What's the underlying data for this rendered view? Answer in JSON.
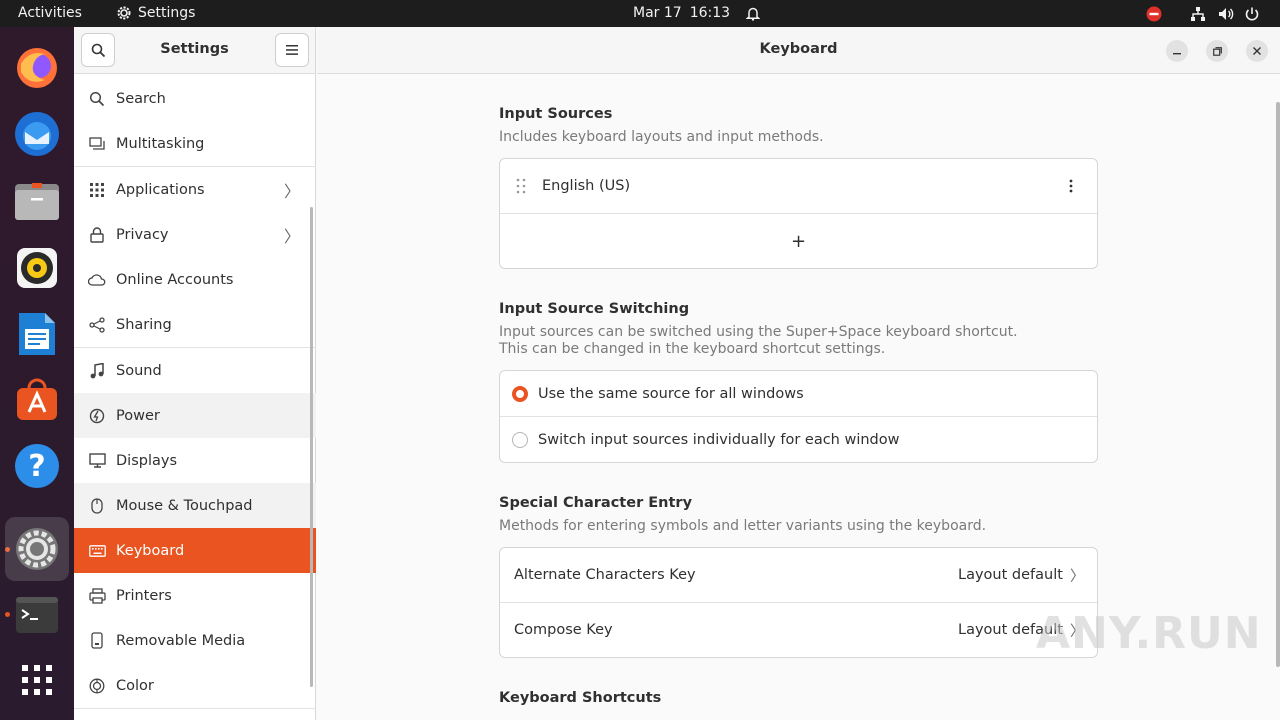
{
  "topbar": {
    "activities": "Activities",
    "app_name": "Settings",
    "date": "Mar 17",
    "time": "16:13"
  },
  "sidebar": {
    "title": "Settings",
    "items": [
      {
        "label": "Search",
        "icon": "search-icon"
      },
      {
        "label": "Multitasking",
        "icon": "multitasking-icon"
      },
      {
        "label": "Applications",
        "icon": "applications-grid-icon"
      },
      {
        "label": "Privacy",
        "icon": "lock-icon"
      },
      {
        "label": "Online Accounts",
        "icon": "cloud-icon"
      },
      {
        "label": "Sharing",
        "icon": "share-icon"
      },
      {
        "label": "Sound",
        "icon": "music-note-icon"
      },
      {
        "label": "Power",
        "icon": "power-icon"
      },
      {
        "label": "Displays",
        "icon": "display-icon"
      },
      {
        "label": "Mouse & Touchpad",
        "icon": "mouse-icon"
      },
      {
        "label": "Keyboard",
        "icon": "keyboard-icon"
      },
      {
        "label": "Printers",
        "icon": "printer-icon"
      },
      {
        "label": "Removable Media",
        "icon": "removable-media-icon"
      },
      {
        "label": "Color",
        "icon": "color-icon"
      }
    ]
  },
  "main": {
    "title": "Keyboard",
    "input_sources": {
      "title": "Input Sources",
      "description": "Includes keyboard layouts and input methods.",
      "source": "English (US)",
      "add": "+"
    },
    "switching": {
      "title": "Input Source Switching",
      "description_1": "Input sources can be switched using the Super+Space keyboard shortcut.",
      "description_2": "This can be changed in the keyboard shortcut settings.",
      "option_same": "Use the same source for all windows",
      "option_individual": "Switch input sources individually for each window",
      "selected": "same"
    },
    "special": {
      "title": "Special Character Entry",
      "description": "Methods for entering symbols and letter variants using the keyboard.",
      "alternate_label": "Alternate Characters Key",
      "alternate_value": "Layout default",
      "compose_label": "Compose Key",
      "compose_value": "Layout default"
    },
    "shortcuts": {
      "title": "Keyboard Shortcuts"
    }
  },
  "watermark": "ANY.RUN",
  "colors": {
    "accent": "#e95420",
    "topbar": "#1d1d1d",
    "dock": "#2b1b2d"
  }
}
